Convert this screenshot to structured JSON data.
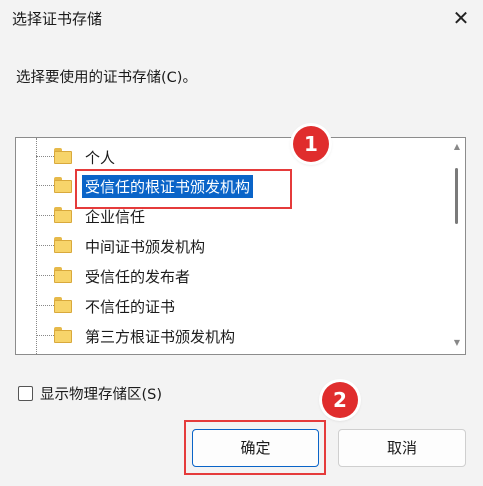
{
  "window": {
    "title": "选择证书存储",
    "close_glyph": "✕"
  },
  "prompt": "选择要使用的证书存储(C)。",
  "tree": {
    "items": [
      {
        "label": "个人",
        "selected": false
      },
      {
        "label": "受信任的根证书颁发机构",
        "selected": true
      },
      {
        "label": "企业信任",
        "selected": false
      },
      {
        "label": "中间证书颁发机构",
        "selected": false
      },
      {
        "label": "受信任的发布者",
        "selected": false
      },
      {
        "label": "不信任的证书",
        "selected": false
      },
      {
        "label": "第三方根证书颁发机构",
        "selected": false
      }
    ]
  },
  "checkbox": {
    "label": "显示物理存储区(S)",
    "checked": false
  },
  "buttons": {
    "ok": "确定",
    "cancel": "取消"
  },
  "annotations": {
    "badge1": "1",
    "badge2": "2"
  },
  "colors": {
    "accent": "#0a64c8",
    "highlight_box": "#e53b3b",
    "badge": "#e02d2d"
  },
  "scrollbar_arrows": {
    "up": "▲",
    "down": "▼"
  }
}
